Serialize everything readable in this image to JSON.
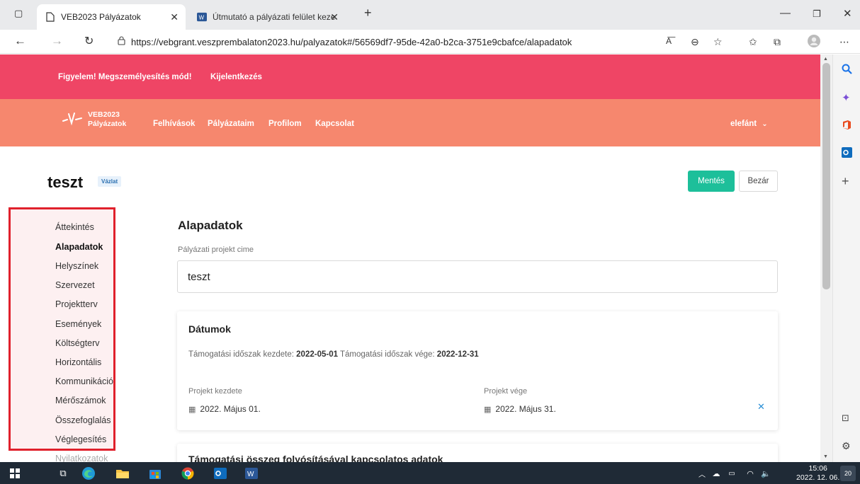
{
  "browser": {
    "tabs": [
      {
        "title": "VEB2023 Pályázatok"
      },
      {
        "title": "Útmutató a pályázati felület keze"
      }
    ],
    "new_tab_glyph": "+",
    "url": "https://vebgrant.veszprembalaton2023.hu/palyazatok#/56569df7-95de-42a0-b2ca-3751e9cbafce/alapadatok"
  },
  "banner": {
    "warning": "Figyelem! Megszemélyesítés mód!",
    "logout": "Kijelentkezés",
    "color": "#ef4565"
  },
  "nav": {
    "logo_line1": "VEB2023",
    "logo_line2": "Pályázatok",
    "links": [
      "Felhívások",
      "Pályázataim",
      "Profilom",
      "Kapcsolat"
    ],
    "user": "elefánt",
    "color": "#f6876e"
  },
  "project": {
    "title": "teszt",
    "status": "Vázlat",
    "save": "Mentés",
    "close": "Bezár",
    "accent": "#1dbf9a"
  },
  "sidebar": {
    "items": [
      {
        "label": "Áttekintés"
      },
      {
        "label": "Alapadatok",
        "active": true
      },
      {
        "label": "Helyszínek"
      },
      {
        "label": "Szervezet"
      },
      {
        "label": "Projektterv"
      },
      {
        "label": "Események"
      },
      {
        "label": "Költségterv"
      },
      {
        "label": "Horizontális"
      },
      {
        "label": "Kommunikáció"
      },
      {
        "label": "Mérőszámok"
      },
      {
        "label": "Összefoglalás"
      },
      {
        "label": "Véglegesítés"
      },
      {
        "label": "Nyilatkozatok"
      }
    ]
  },
  "main": {
    "heading": "Alapadatok",
    "title_label": "Pályázati projekt cime",
    "title_value": "teszt",
    "dates": {
      "heading": "Dátumok",
      "period_start_label": "Támogatási időszak kezdete:",
      "period_start": "2022-05-01",
      "period_end_label": "Támogatási időszak vége:",
      "period_end": "2022-12-31",
      "start_label": "Projekt kezdete",
      "start_value": "2022. Május 01.",
      "end_label": "Projekt vége",
      "end_value": "2022. Május 31."
    },
    "next_heading": "Támogatási összeg folyósításával kapcsolatos adatok"
  },
  "taskbar": {
    "time": "15:06",
    "date": "2022. 12. 06.",
    "notifications": "20"
  }
}
